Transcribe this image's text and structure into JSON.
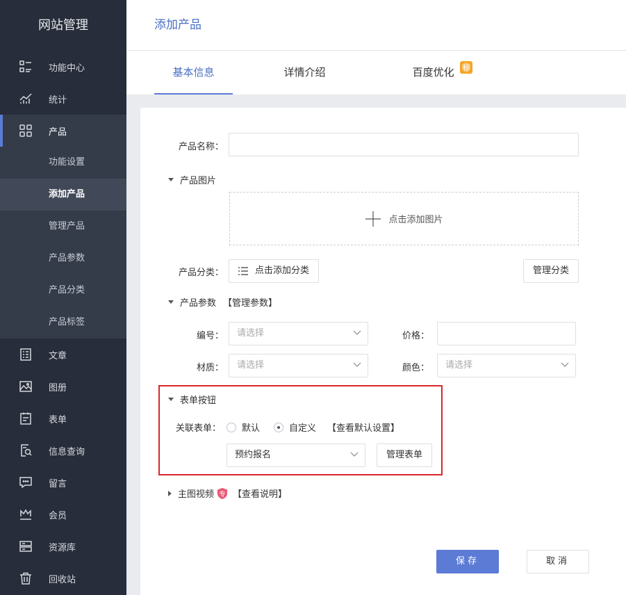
{
  "sidebar": {
    "brand": "网站管理",
    "items": [
      {
        "label": "功能中心",
        "icon": "function-center-icon"
      },
      {
        "label": "统计",
        "icon": "statistics-icon"
      },
      {
        "label": "产品",
        "icon": "product-grid-icon"
      }
    ],
    "product_sub": [
      "功能设置",
      "添加产品",
      "管理产品",
      "产品参数",
      "产品分类",
      "产品标签"
    ],
    "more_items": [
      {
        "label": "文章",
        "icon": "article-icon"
      },
      {
        "label": "图册",
        "icon": "gallery-icon"
      },
      {
        "label": "表单",
        "icon": "form-icon"
      },
      {
        "label": "信息查询",
        "icon": "info-query-icon"
      },
      {
        "label": "留言",
        "icon": "message-icon"
      },
      {
        "label": "会员",
        "icon": "member-crown-icon"
      },
      {
        "label": "资源库",
        "icon": "resource-icon"
      },
      {
        "label": "回收站",
        "icon": "trash-icon"
      }
    ]
  },
  "header": {
    "title": "添加产品"
  },
  "tabs": [
    {
      "label": "基本信息"
    },
    {
      "label": "详情介绍"
    },
    {
      "label": "百度优化",
      "badge": "标"
    }
  ],
  "form": {
    "name_label": "产品名称：",
    "name_value": "",
    "images_section": "产品图片",
    "upload_text": "点击添加图片",
    "category_label": "产品分类：",
    "category_button": "点击添加分类",
    "manage_category": "管理分类",
    "params_section": "产品参数",
    "params_link": "【管理参数】",
    "code_label": "编号：",
    "code_placeholder": "请选择",
    "price_label": "价格：",
    "price_value": "",
    "material_label": "材质：",
    "material_placeholder": "请选择",
    "color_label": "颜色：",
    "color_placeholder": "请选择",
    "form_button_section": "表单按钮",
    "linked_form_label": "关联表单：",
    "radio_default": "默认",
    "radio_custom": "自定义",
    "view_default_link": "【查看默认设置】",
    "form_select_value": "预约报名",
    "manage_form": "管理表单",
    "video_section": "主图视频",
    "video_badge": "专",
    "video_link": "【查看说明】"
  },
  "actions": {
    "save": "保存",
    "cancel": "取消"
  },
  "colors": {
    "accent": "#5b7bd5",
    "sidebar": "#272d3a",
    "highlight": "#d8262a"
  }
}
